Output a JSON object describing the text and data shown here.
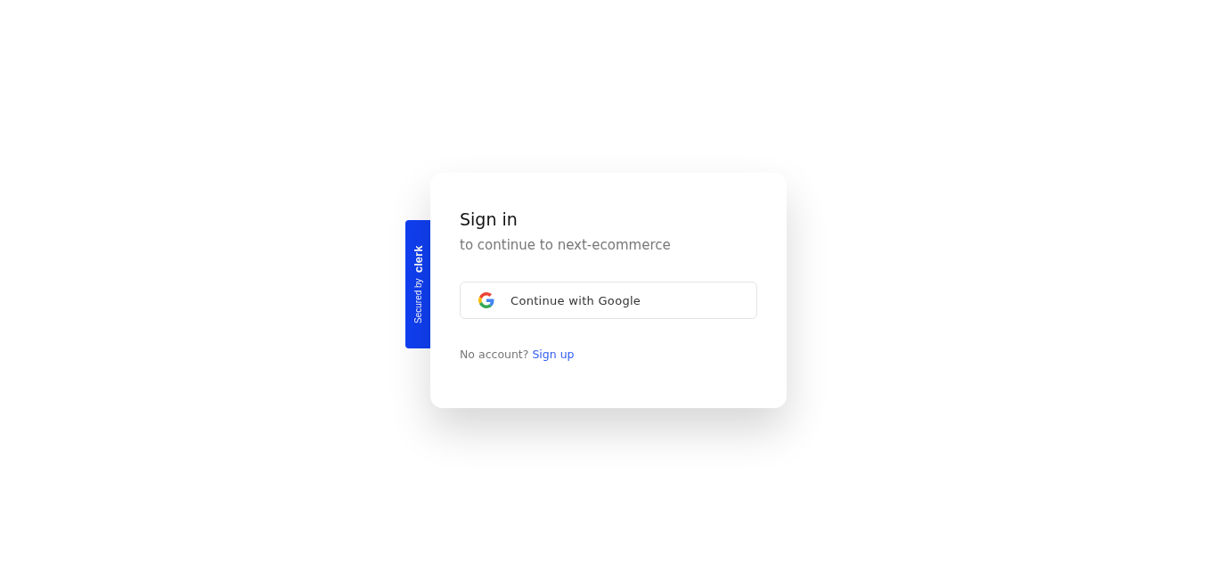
{
  "badge": {
    "prefix": "Secured by",
    "brand": "clerk"
  },
  "card": {
    "title": "Sign in",
    "subtitle": "to continue to next-ecommerce",
    "provider_button": "Continue with Google",
    "footer_text": "No account?",
    "footer_link": "Sign up"
  }
}
